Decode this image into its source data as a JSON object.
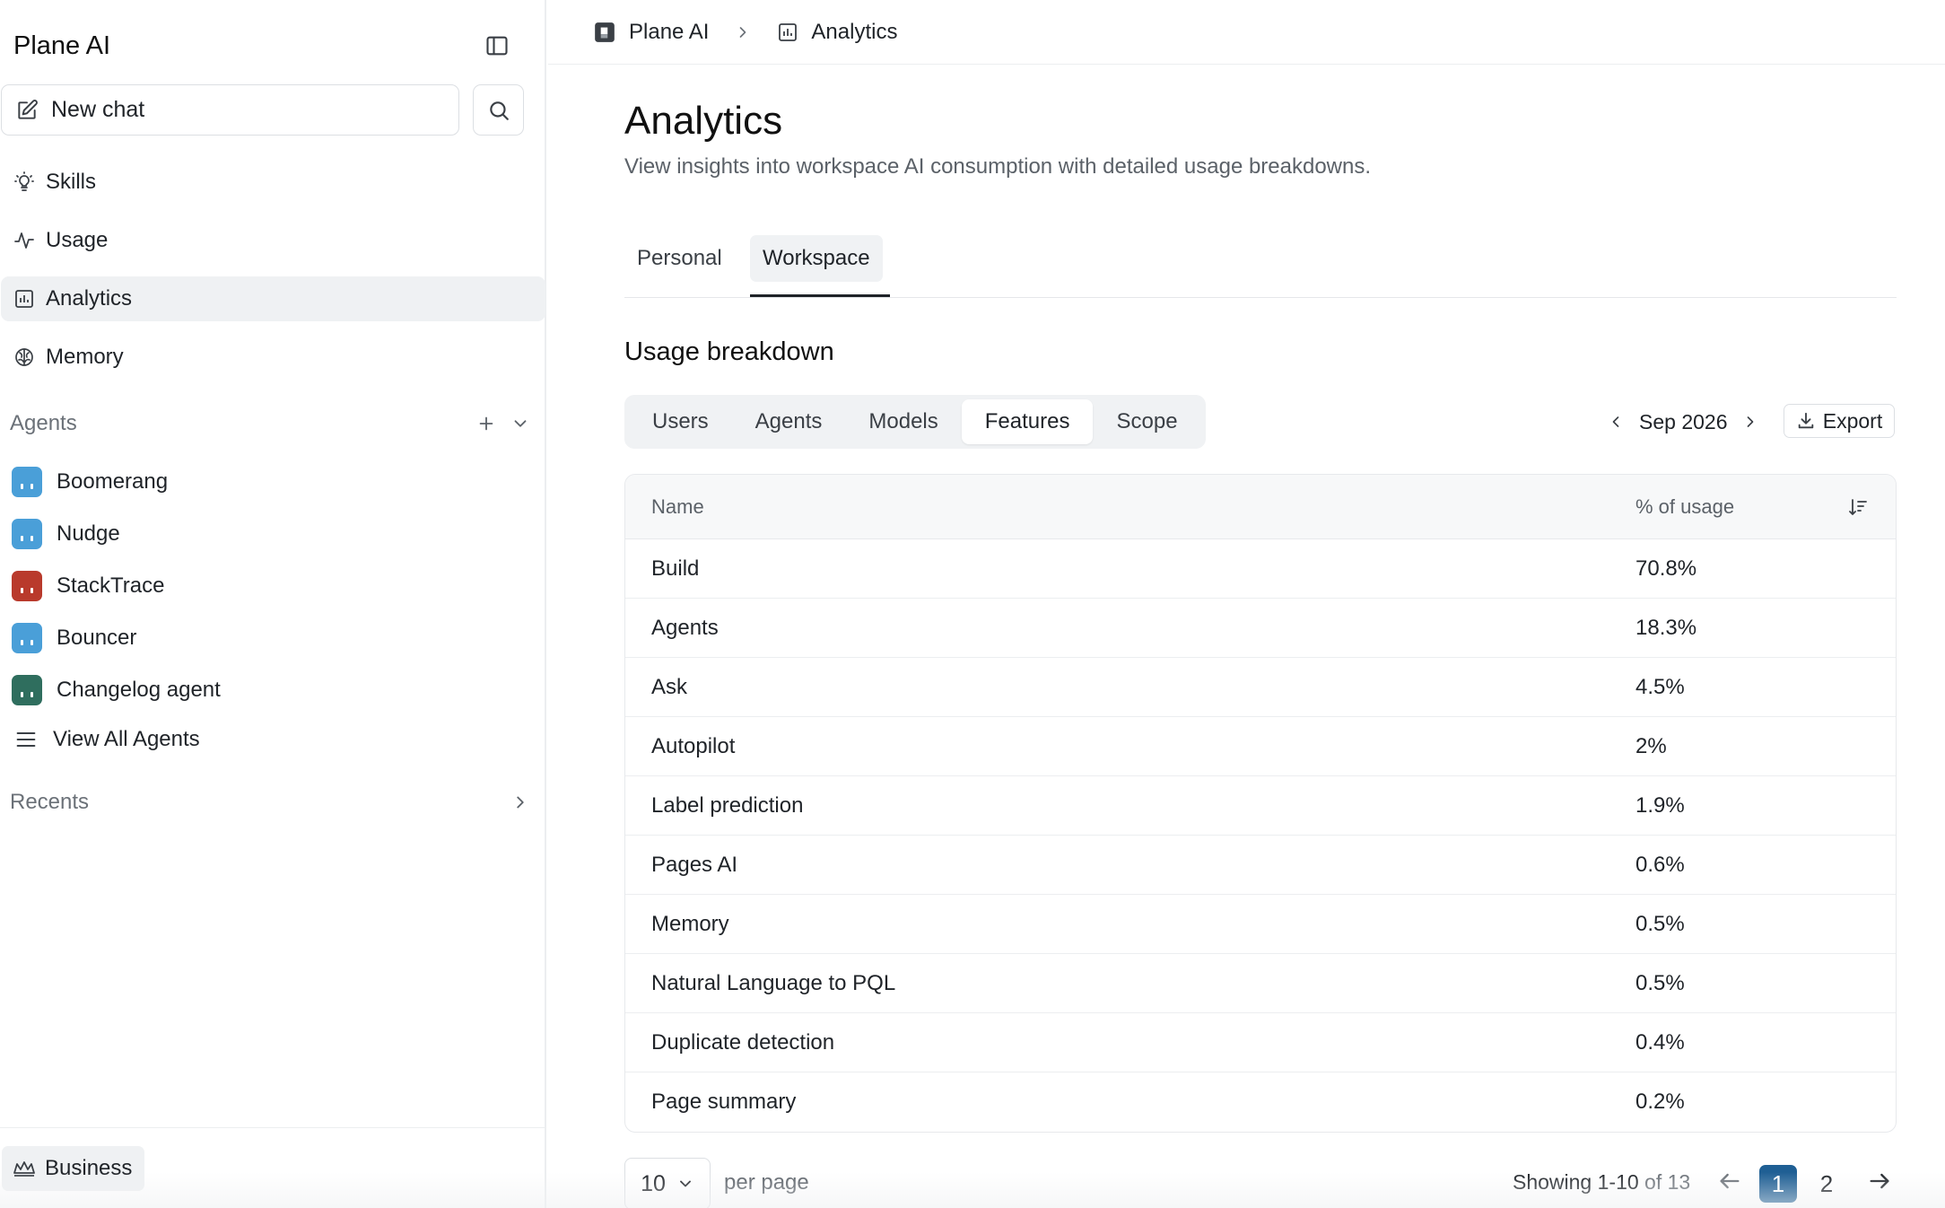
{
  "sidebar": {
    "app_title": "Plane AI",
    "new_chat_label": "New chat",
    "nav": [
      {
        "label": "Skills",
        "icon": "lightbulb-icon"
      },
      {
        "label": "Usage",
        "icon": "activity-icon"
      },
      {
        "label": "Analytics",
        "icon": "bar-chart-icon",
        "active": true
      },
      {
        "label": "Memory",
        "icon": "brain-icon"
      }
    ],
    "agents_heading": "Agents",
    "agents": [
      {
        "name": "Boomerang",
        "color": "#4a9fd8"
      },
      {
        "name": "Nudge",
        "color": "#4a9fd8"
      },
      {
        "name": "StackTrace",
        "color": "#b93a2c"
      },
      {
        "name": "Bouncer",
        "color": "#4a9fd8"
      },
      {
        "name": "Changelog agent",
        "color": "#2f6e5e"
      }
    ],
    "view_all_label": "View All Agents",
    "recents_heading": "Recents",
    "plan_label": "Business"
  },
  "breadcrumb": {
    "root": "Plane AI",
    "current": "Analytics"
  },
  "page": {
    "title": "Analytics",
    "description": "View insights into workspace AI consumption with detailed usage breakdowns."
  },
  "tabs": [
    {
      "label": "Personal",
      "active": false
    },
    {
      "label": "Workspace",
      "active": true
    }
  ],
  "breakdown": {
    "title": "Usage breakdown",
    "segments": [
      {
        "label": "Users",
        "active": false
      },
      {
        "label": "Agents",
        "active": false
      },
      {
        "label": "Models",
        "active": false
      },
      {
        "label": "Features",
        "active": true
      },
      {
        "label": "Scope",
        "active": false
      }
    ],
    "month": "Sep 2026",
    "export_label": "Export"
  },
  "table": {
    "headers": {
      "name": "Name",
      "pct": "% of usage"
    },
    "rows": [
      {
        "name": "Build",
        "pct": "70.8%"
      },
      {
        "name": "Agents",
        "pct": "18.3%"
      },
      {
        "name": "Ask",
        "pct": "4.5%"
      },
      {
        "name": "Autopilot",
        "pct": "2%"
      },
      {
        "name": "Label prediction",
        "pct": "1.9%"
      },
      {
        "name": "Pages AI",
        "pct": "0.6%"
      },
      {
        "name": "Memory",
        "pct": "0.5%"
      },
      {
        "name": "Natural Language to PQL",
        "pct": "0.5%"
      },
      {
        "name": "Duplicate detection",
        "pct": "0.4%"
      },
      {
        "name": "Page summary",
        "pct": "0.2%"
      }
    ]
  },
  "pagination": {
    "per_page_value": "10",
    "per_page_label": "per page",
    "showing_range": "Showing 1-10",
    "showing_total": "of 13",
    "pages": [
      "1",
      "2"
    ],
    "current_page": "1"
  },
  "colors": {
    "accent": "#1f5f94",
    "active_bg": "#eff1f3"
  }
}
